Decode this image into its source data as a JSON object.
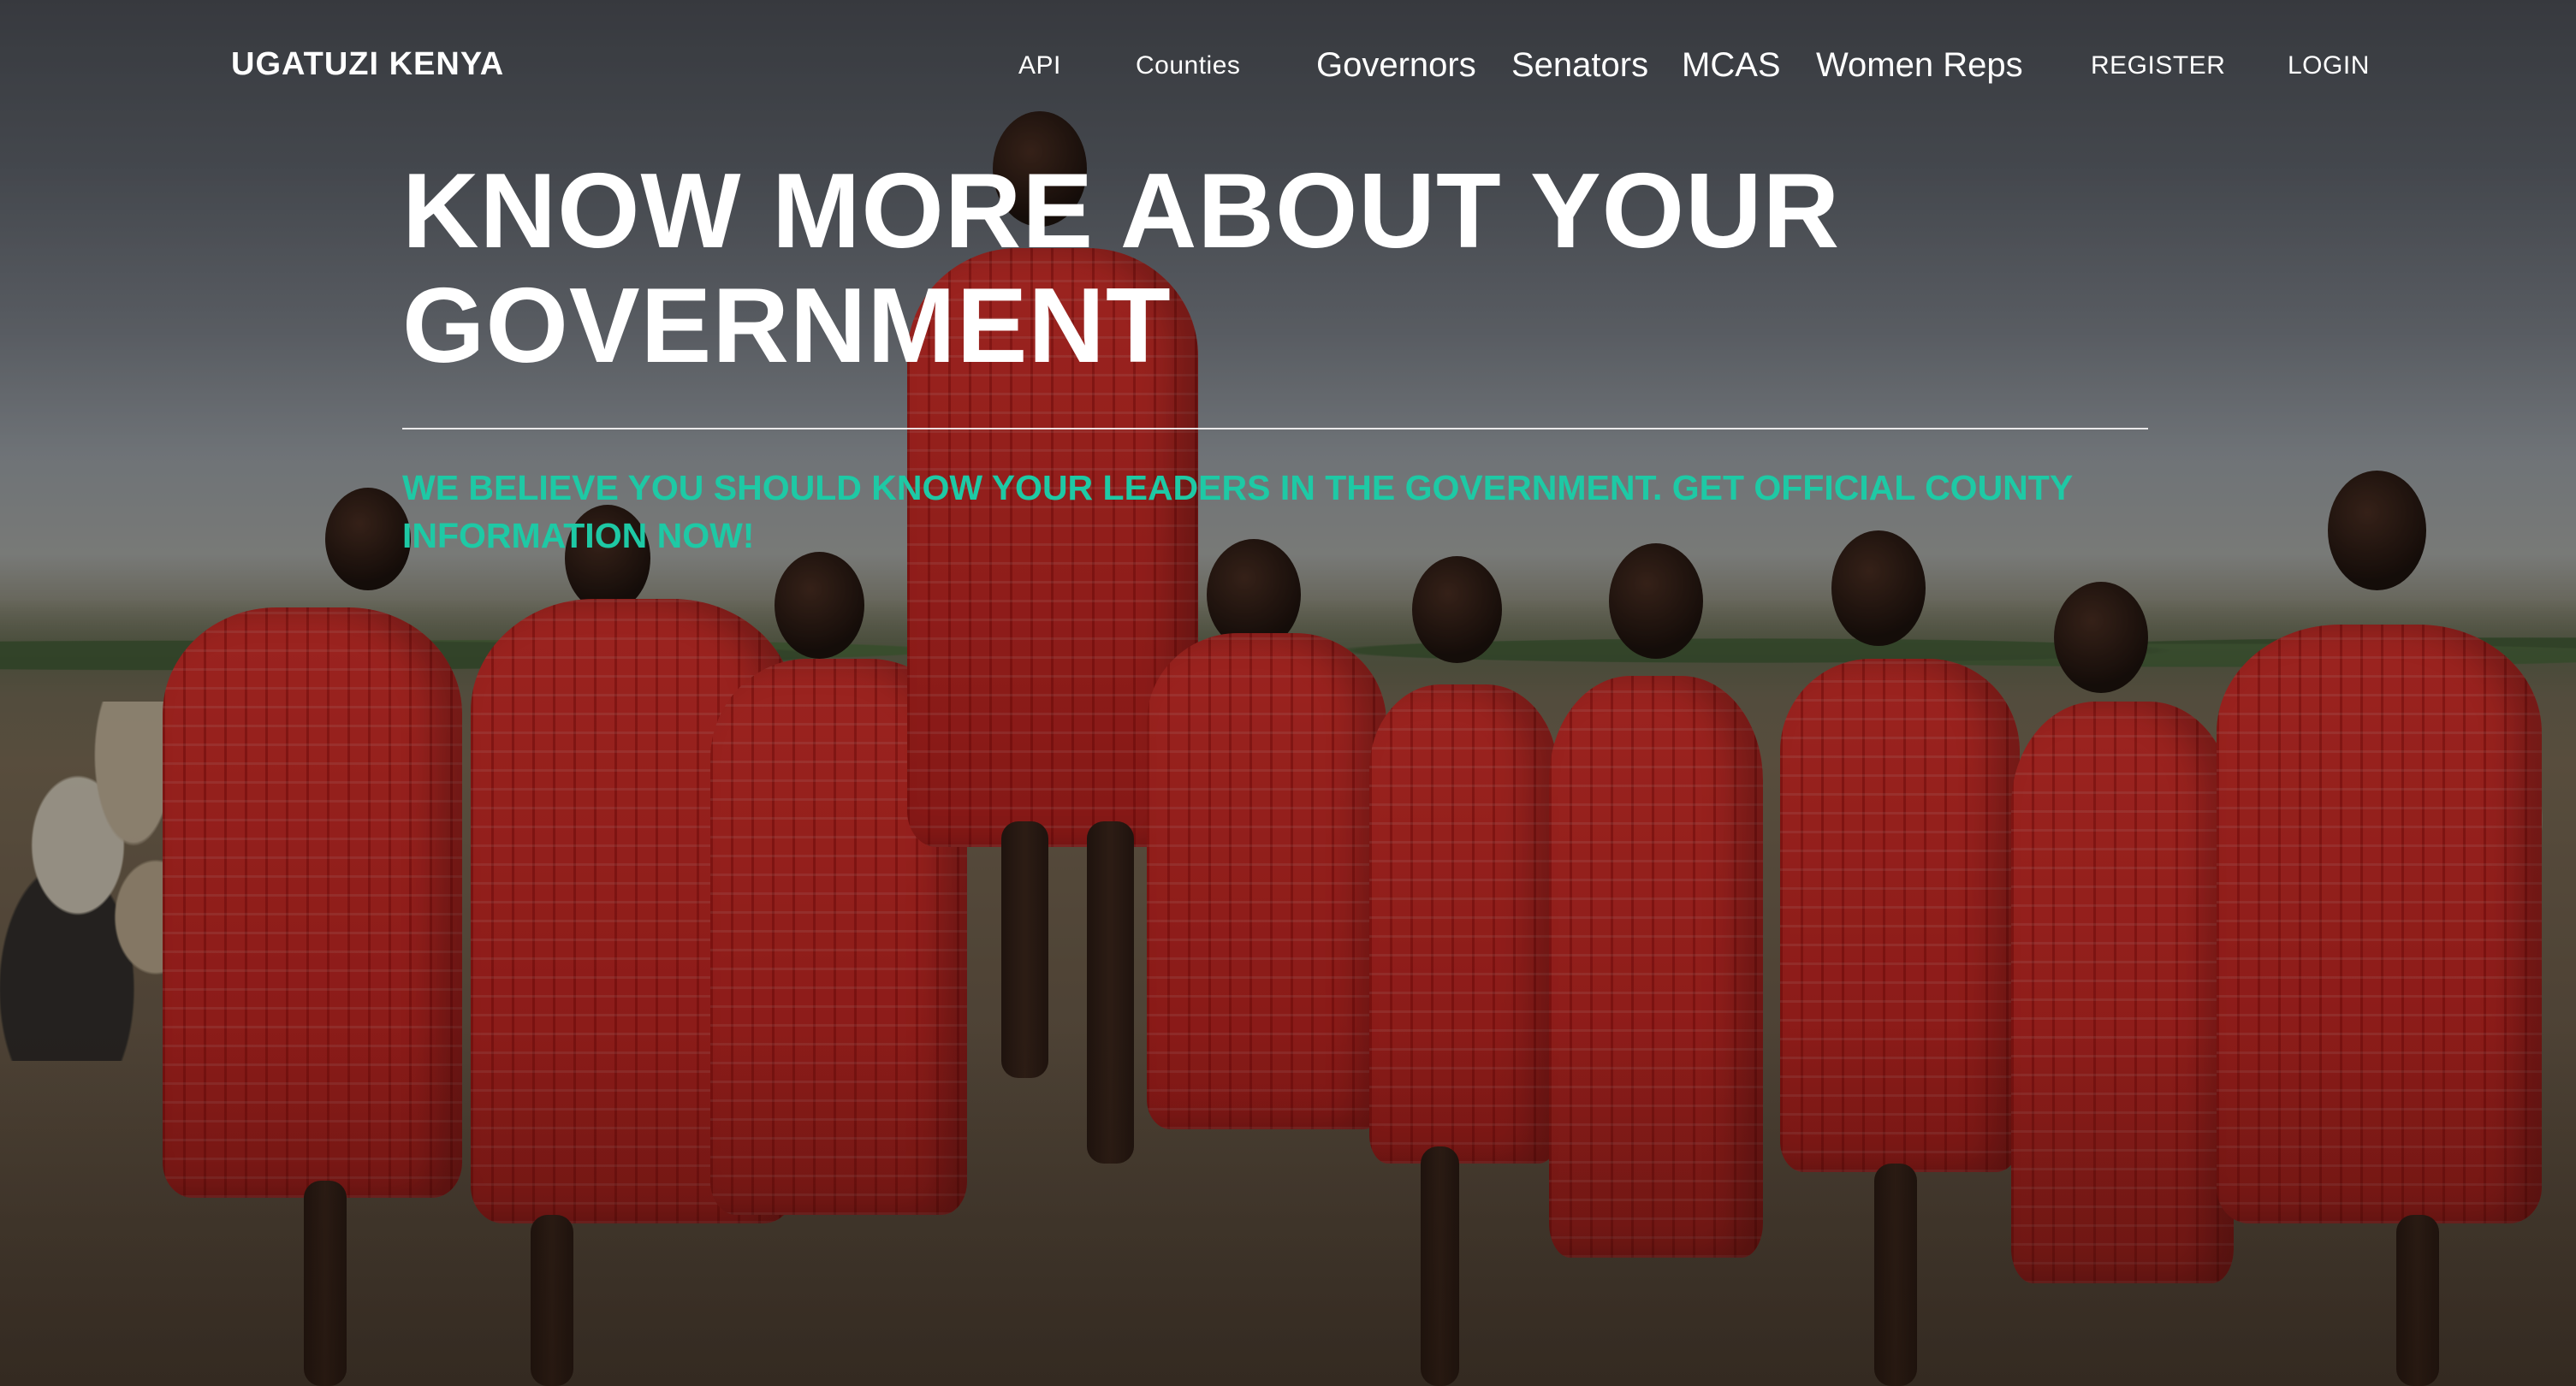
{
  "navbar": {
    "brand": "UGATUZI KENYA",
    "links_small": {
      "api": "API",
      "counties": "Counties"
    },
    "links_large": {
      "governors": "Governors",
      "senators": "Senators",
      "mcas": "MCAS",
      "women_reps": "Women Reps"
    },
    "auth": {
      "register": "REGISTER",
      "login": "LOGIN"
    }
  },
  "hero": {
    "title": "KNOW MORE ABOUT YOUR GOVERNMENT",
    "subtitle": "WE BELIEVE YOU SHOULD KNOW YOUR LEADERS IN THE GOVERNMENT. GET OFFICIAL COUNTY INFORMATION NOW!",
    "subtitle_color": "#1ec9a5",
    "background_image_subject": "maasai-dancers-photo"
  }
}
